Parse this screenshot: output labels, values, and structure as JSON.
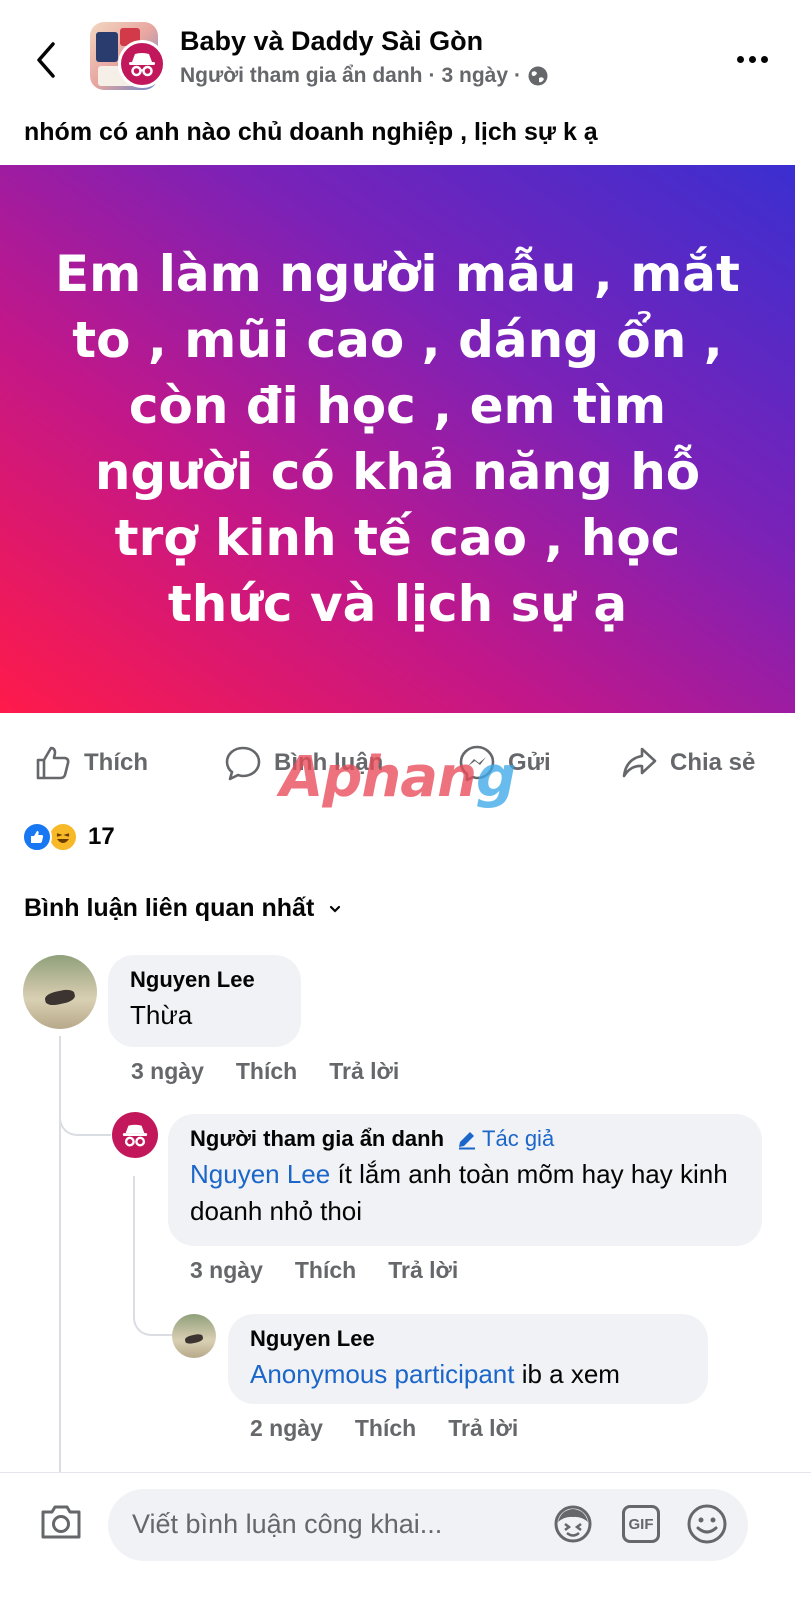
{
  "header": {
    "group_name": "Baby và Daddy Sài Gòn",
    "author": "Người tham gia ẩn danh",
    "separator": "·",
    "time": "3 ngày",
    "privacy_icon": "globe-icon"
  },
  "post": {
    "text": "nhóm có anh nào chủ doanh nghiệp , lịch sự k ạ",
    "banner_text": "Em làm người mẫu , mắt to , mũi cao , dáng ổn , còn đi học , em tìm người có khả năng hỗ trợ kinh tế cao , học thức và lịch sự ạ",
    "banner_colors": [
      "#ff1a4a",
      "#c1178a",
      "#7a22b8",
      "#3b2fd0"
    ]
  },
  "actions": {
    "like": "Thích",
    "comment": "Bình luận",
    "send": "Gửi",
    "share": "Chia sẻ"
  },
  "watermark": {
    "part1": "Aphan",
    "part2": "g"
  },
  "reactions": {
    "count": "17",
    "icons": [
      "like-icon",
      "haha-icon"
    ]
  },
  "comments_sort": {
    "label": "Bình luận liên quan nhất"
  },
  "comments": [
    {
      "author": "Nguyen Lee",
      "text": "Thừa",
      "time": "3 ngày",
      "like": "Thích",
      "reply": "Trả lời"
    },
    {
      "author": "Người tham gia ẩn danh",
      "badge": "Tác giả",
      "mention": "Nguyen Lee",
      "text": " ít lắm anh toàn mõm hay hay kinh doanh nhỏ thoi",
      "time": "3 ngày",
      "like": "Thích",
      "reply": "Trả lời"
    },
    {
      "author": "Nguyen Lee",
      "mention": "Anonymous participant",
      "text": " ib a xem",
      "time": "2 ngày",
      "like": "Thích",
      "reply": "Trả lời"
    }
  ],
  "composer": {
    "placeholder": "Viết bình luận công khai...",
    "gif_label": "GIF"
  },
  "colors": {
    "link_blue": "#1b66c9",
    "secondary_text": "#65676b",
    "bubble_bg": "#f0f2f5",
    "anon_magenta": "#c2185b"
  }
}
